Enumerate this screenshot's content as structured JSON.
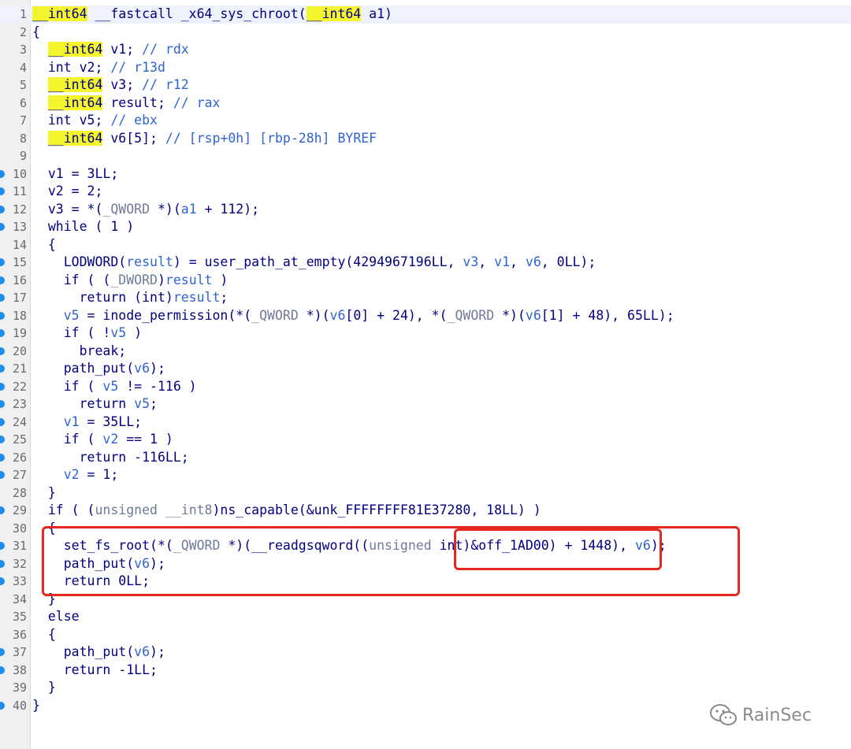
{
  "code": {
    "lines": [
      {
        "n": "1",
        "bp": false,
        "html": "<span class=\"hl\">__int64</span> __fastcall _x64_sys_chroot(<span class=\"hl\">__int64</span> a1)"
      },
      {
        "n": "2",
        "bp": false,
        "html": "{"
      },
      {
        "n": "3",
        "bp": false,
        "html": "  <span class=\"hl\">__int64</span> v1; <span class=\"c\">// rdx</span>"
      },
      {
        "n": "4",
        "bp": false,
        "html": "  int v2; <span class=\"c\">// r13d</span>"
      },
      {
        "n": "5",
        "bp": false,
        "html": "  <span class=\"hl\">__int64</span> v3; <span class=\"c\">// r12</span>"
      },
      {
        "n": "6",
        "bp": false,
        "html": "  <span class=\"hl\">__int64</span> result; <span class=\"c\">// rax</span>"
      },
      {
        "n": "7",
        "bp": false,
        "html": "  int v5; <span class=\"c\">// ebx</span>"
      },
      {
        "n": "8",
        "bp": false,
        "html": "  <span class=\"hl\">__int64</span> v6[5]; <span class=\"c\">// [rsp+0h] [rbp-28h] BYREF</span>"
      },
      {
        "n": "9",
        "bp": false,
        "html": ""
      },
      {
        "n": "10",
        "bp": true,
        "html": "  v1 = 3LL;"
      },
      {
        "n": "11",
        "bp": true,
        "html": "  v2 = 2;"
      },
      {
        "n": "12",
        "bp": true,
        "html": "  v3 = *(<span class=\"g\">_QWORD</span> *)(<span class=\"c\">a1</span> + 112);"
      },
      {
        "n": "13",
        "bp": true,
        "html": "  while ( 1 )"
      },
      {
        "n": "14",
        "bp": false,
        "html": "  {"
      },
      {
        "n": "15",
        "bp": true,
        "html": "    LODWORD(<span class=\"c\">result</span>) = user_path_at_empty(4294967196LL, <span class=\"c\">v3</span>, <span class=\"c\">v1</span>, <span class=\"c\">v6</span>, 0LL);"
      },
      {
        "n": "16",
        "bp": true,
        "html": "    if ( (<span class=\"g\">_DWORD</span>)<span class=\"c\">result</span> )"
      },
      {
        "n": "17",
        "bp": true,
        "html": "      return (int)<span class=\"c\">result</span>;"
      },
      {
        "n": "18",
        "bp": true,
        "html": "    <span class=\"c\">v5</span> = inode_permission(*(<span class=\"g\">_QWORD</span> *)(<span class=\"c\">v6</span>[0] + 24), *(<span class=\"g\">_QWORD</span> *)(<span class=\"c\">v6</span>[1] + 48), 65LL);"
      },
      {
        "n": "19",
        "bp": true,
        "html": "    if ( !<span class=\"c\">v5</span> )"
      },
      {
        "n": "20",
        "bp": true,
        "html": "      break;"
      },
      {
        "n": "21",
        "bp": true,
        "html": "    path_put(<span class=\"c\">v6</span>);"
      },
      {
        "n": "22",
        "bp": true,
        "html": "    if ( <span class=\"c\">v5</span> != -116 )"
      },
      {
        "n": "23",
        "bp": true,
        "html": "      return <span class=\"c\">v5</span>;"
      },
      {
        "n": "24",
        "bp": true,
        "html": "    <span class=\"c\">v1</span> = 35LL;"
      },
      {
        "n": "25",
        "bp": true,
        "html": "    if ( <span class=\"c\">v2</span> == 1 )"
      },
      {
        "n": "26",
        "bp": true,
        "html": "      return -116LL;"
      },
      {
        "n": "27",
        "bp": true,
        "html": "    <span class=\"c\">v2</span> = 1;"
      },
      {
        "n": "28",
        "bp": false,
        "html": "  }"
      },
      {
        "n": "29",
        "bp": true,
        "html": "  if ( (<span class=\"g\">unsigned __int8</span>)ns_capable(&amp;unk_FFFFFFFF81E37280, 18LL) )"
      },
      {
        "n": "30",
        "bp": false,
        "html": "  {"
      },
      {
        "n": "31",
        "bp": true,
        "html": "    set_fs_root(*(<span class=\"g\">_QWORD</span> *)(__readgsqword((<span class=\"g\">unsigned</span> int)&amp;off_1AD00) + 1448), <span class=\"c\">v6</span>);"
      },
      {
        "n": "32",
        "bp": true,
        "html": "    path_put(<span class=\"c\">v6</span>);"
      },
      {
        "n": "33",
        "bp": true,
        "html": "    return 0LL;"
      },
      {
        "n": "34",
        "bp": false,
        "html": "  }"
      },
      {
        "n": "35",
        "bp": false,
        "html": "  else"
      },
      {
        "n": "36",
        "bp": false,
        "html": "  {"
      },
      {
        "n": "37",
        "bp": true,
        "html": "    path_put(<span class=\"c\">v6</span>);"
      },
      {
        "n": "38",
        "bp": true,
        "html": "    return -1LL;"
      },
      {
        "n": "39",
        "bp": false,
        "html": "  }"
      },
      {
        "n": "40",
        "bp": true,
        "html": "}"
      }
    ],
    "current_line": "1"
  },
  "watermark": {
    "text": "RainSec",
    "icon": "wechat-icon"
  },
  "colors": {
    "keyword_highlight": "#f5f52e",
    "code_text": "#000080",
    "variable": "#2f63d4",
    "type_cast": "#6f7b9a",
    "breakpoint_dot": "#1d8ef0",
    "annotation_box": "#e5281e"
  }
}
